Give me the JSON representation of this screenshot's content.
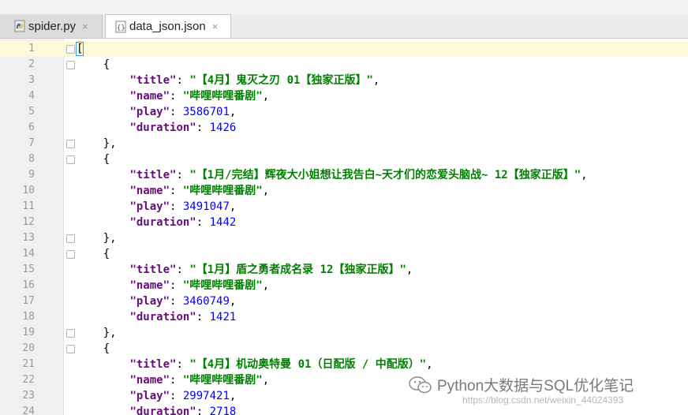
{
  "tabs": [
    {
      "label": "spider.py",
      "icon": "python-file-icon",
      "active": false
    },
    {
      "label": "data_json.json",
      "icon": "json-file-icon",
      "active": true
    }
  ],
  "close_glyph": "×",
  "lines": [
    {
      "n": "1",
      "t": [
        [
          "pun",
          "["
        ]
      ]
    },
    {
      "n": "2",
      "t": [
        [
          "pun",
          "    {"
        ]
      ]
    },
    {
      "n": "3",
      "t": [
        [
          "pun",
          "        "
        ],
        [
          "key",
          "\"title\""
        ],
        [
          "pun",
          ": "
        ],
        [
          "str",
          "\"【4月】鬼灭之刃 01【独家正版】\""
        ],
        [
          "pun",
          ","
        ]
      ]
    },
    {
      "n": "4",
      "t": [
        [
          "pun",
          "        "
        ],
        [
          "key",
          "\"name\""
        ],
        [
          "pun",
          ": "
        ],
        [
          "str",
          "\"哔哩哔哩番剧\""
        ],
        [
          "pun",
          ","
        ]
      ]
    },
    {
      "n": "5",
      "t": [
        [
          "pun",
          "        "
        ],
        [
          "key",
          "\"play\""
        ],
        [
          "pun",
          ": "
        ],
        [
          "num",
          "3586701"
        ],
        [
          "pun",
          ","
        ]
      ]
    },
    {
      "n": "6",
      "t": [
        [
          "pun",
          "        "
        ],
        [
          "key",
          "\"duration\""
        ],
        [
          "pun",
          ": "
        ],
        [
          "num",
          "1426"
        ]
      ]
    },
    {
      "n": "7",
      "t": [
        [
          "pun",
          "    },"
        ]
      ]
    },
    {
      "n": "8",
      "t": [
        [
          "pun",
          "    {"
        ]
      ]
    },
    {
      "n": "9",
      "t": [
        [
          "pun",
          "        "
        ],
        [
          "key",
          "\"title\""
        ],
        [
          "pun",
          ": "
        ],
        [
          "str",
          "\"【1月/完结】辉夜大小姐想让我告白~天才们的恋爱头脑战~ 12【独家正版】\""
        ],
        [
          "pun",
          ","
        ]
      ]
    },
    {
      "n": "10",
      "t": [
        [
          "pun",
          "        "
        ],
        [
          "key",
          "\"name\""
        ],
        [
          "pun",
          ": "
        ],
        [
          "str",
          "\"哔哩哔哩番剧\""
        ],
        [
          "pun",
          ","
        ]
      ]
    },
    {
      "n": "11",
      "t": [
        [
          "pun",
          "        "
        ],
        [
          "key",
          "\"play\""
        ],
        [
          "pun",
          ": "
        ],
        [
          "num",
          "3491047"
        ],
        [
          "pun",
          ","
        ]
      ]
    },
    {
      "n": "12",
      "t": [
        [
          "pun",
          "        "
        ],
        [
          "key",
          "\"duration\""
        ],
        [
          "pun",
          ": "
        ],
        [
          "num",
          "1442"
        ]
      ]
    },
    {
      "n": "13",
      "t": [
        [
          "pun",
          "    },"
        ]
      ]
    },
    {
      "n": "14",
      "t": [
        [
          "pun",
          "    {"
        ]
      ]
    },
    {
      "n": "15",
      "t": [
        [
          "pun",
          "        "
        ],
        [
          "key",
          "\"title\""
        ],
        [
          "pun",
          ": "
        ],
        [
          "str",
          "\"【1月】盾之勇者成名录 12【独家正版】\""
        ],
        [
          "pun",
          ","
        ]
      ]
    },
    {
      "n": "16",
      "t": [
        [
          "pun",
          "        "
        ],
        [
          "key",
          "\"name\""
        ],
        [
          "pun",
          ": "
        ],
        [
          "str",
          "\"哔哩哔哩番剧\""
        ],
        [
          "pun",
          ","
        ]
      ]
    },
    {
      "n": "17",
      "t": [
        [
          "pun",
          "        "
        ],
        [
          "key",
          "\"play\""
        ],
        [
          "pun",
          ": "
        ],
        [
          "num",
          "3460749"
        ],
        [
          "pun",
          ","
        ]
      ]
    },
    {
      "n": "18",
      "t": [
        [
          "pun",
          "        "
        ],
        [
          "key",
          "\"duration\""
        ],
        [
          "pun",
          ": "
        ],
        [
          "num",
          "1421"
        ]
      ]
    },
    {
      "n": "19",
      "t": [
        [
          "pun",
          "    },"
        ]
      ]
    },
    {
      "n": "20",
      "t": [
        [
          "pun",
          "    {"
        ]
      ]
    },
    {
      "n": "21",
      "t": [
        [
          "pun",
          "        "
        ],
        [
          "key",
          "\"title\""
        ],
        [
          "pun",
          ": "
        ],
        [
          "str",
          "\"【4月】机动奥特曼 01（日配版 / 中配版）\""
        ],
        [
          "pun",
          ","
        ]
      ]
    },
    {
      "n": "22",
      "t": [
        [
          "pun",
          "        "
        ],
        [
          "key",
          "\"name\""
        ],
        [
          "pun",
          ": "
        ],
        [
          "str",
          "\"哔哩哔哩番剧\""
        ],
        [
          "pun",
          ","
        ]
      ]
    },
    {
      "n": "23",
      "t": [
        [
          "pun",
          "        "
        ],
        [
          "key",
          "\"play\""
        ],
        [
          "pun",
          ": "
        ],
        [
          "num",
          "2997421"
        ],
        [
          "pun",
          ","
        ]
      ]
    },
    {
      "n": "24",
      "t": [
        [
          "pun",
          "        "
        ],
        [
          "key",
          "\"duration\""
        ],
        [
          "pun",
          ": "
        ],
        [
          "num",
          "2718"
        ]
      ]
    }
  ],
  "fold_lines": [
    "1",
    "2",
    "7",
    "8",
    "13",
    "14",
    "19",
    "20"
  ],
  "watermark": {
    "text": "Python大数据与SQL优化笔记",
    "icon": "wechat-icon"
  },
  "url_text": "https://blog.csdn.net/weixin_44024393"
}
